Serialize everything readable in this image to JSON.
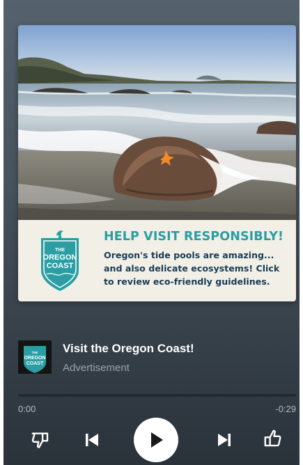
{
  "ad": {
    "headline": "HELP VISIT RESPONSIBLY!",
    "body": "Oregon's tide pools are amazing... and also delicate ecosystems! Click to review eco-friendly guidelines.",
    "badge_line1": "THE",
    "badge_line2": "OREGON",
    "badge_line3": "COAST"
  },
  "track": {
    "title": "Visit the Oregon Coast!",
    "subtitle": "Advertisement",
    "thumb_line1": "THE",
    "thumb_line2": "OREGON",
    "thumb_line3": "COAST"
  },
  "playback": {
    "elapsed": "0:00",
    "remaining": "-0:29",
    "progress_fraction": 0.0
  },
  "controls": {
    "thumbs_down": "thumbs-down-icon",
    "previous": "skip-previous-icon",
    "play": "play-icon",
    "next": "skip-next-icon",
    "thumbs_up": "thumbs-up-icon"
  },
  "colors": {
    "accent_teal": "#2a9ea3",
    "banner_bg": "#f2efe6",
    "body_text": "#183c55",
    "player_bg": "#46525c"
  }
}
